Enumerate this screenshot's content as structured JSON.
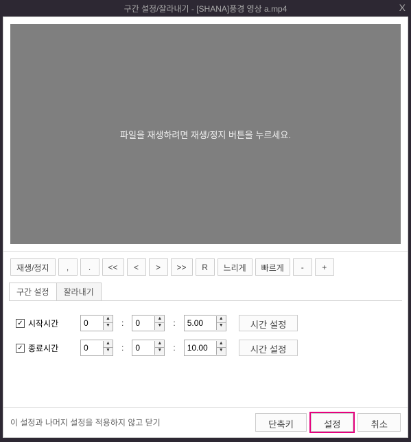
{
  "title": "구간 설정/잘라내기 - [SHANA]풍경 영상 a.mp4",
  "close_label": "X",
  "preview_message": "파일을 재생하려면 재생/정지 버튼을 누르세요.",
  "controls": {
    "play_pause": "재생/정지",
    "comma": ",",
    "dot": ".",
    "rew2": "<<",
    "rew1": "<",
    "fwd1": ">",
    "fwd2": ">>",
    "reset": "R",
    "slower": "느리게",
    "faster": "빠르게",
    "minus": "-",
    "plus": "+"
  },
  "tabs": {
    "range": "구간 설정",
    "cut": "잘라내기"
  },
  "range": {
    "start_label": "시작시간",
    "start_checked": "✓",
    "start_h": "0",
    "start_m": "0",
    "start_s": "5.00",
    "end_label": "종료시간",
    "end_checked": "✓",
    "end_h": "0",
    "end_m": "0",
    "end_s": "10.00",
    "set_time": "시간 설정"
  },
  "bottom": {
    "note": "이 설정과 나머지 설정을 적용하지 않고 닫기",
    "shortcut": "단축키",
    "apply": "설정",
    "cancel": "취소"
  }
}
